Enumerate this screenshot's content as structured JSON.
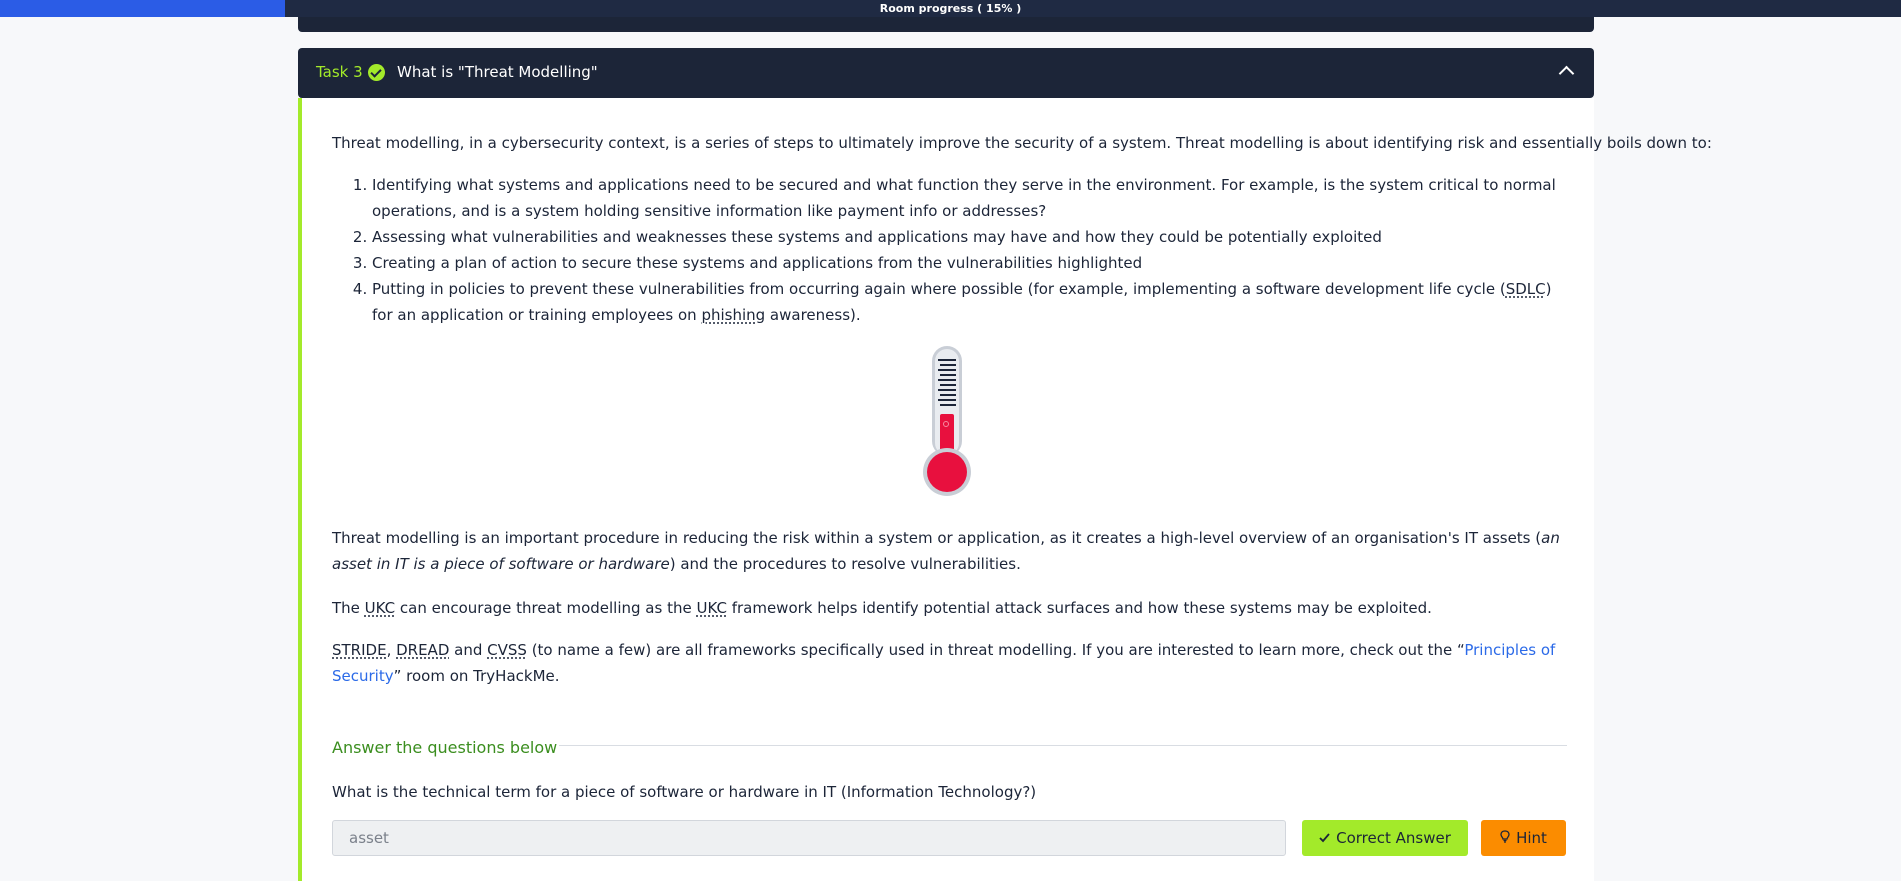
{
  "progress": {
    "label": "Room progress ( 15% )",
    "percent": 15
  },
  "task": {
    "number": "Task 3",
    "title": "What is \"Threat Modelling\""
  },
  "content": {
    "intro": "Threat modelling, in a cybersecurity context, is a series of steps to ultimately improve the security of a system. Threat modelling is about identifying risk and essentially boils down to:",
    "steps": [
      "Identifying what systems and applications need to be secured and what function they serve in the environment. For example, is the system critical to normal operations, and is a system holding sensitive information like payment info or addresses?",
      "Assessing what vulnerabilities and weaknesses these systems and applications may have and how they could be potentially exploited",
      "Creating a plan of action to secure these systems and applications from the vulnerabilities highlighted"
    ],
    "step4": {
      "before": "Putting in policies to prevent these vulnerabilities from occurring again where possible (for example, implementing a software development life cycle (",
      "abbr1": "SDLC",
      "middle": ") for an application or training employees on ",
      "abbr2": "phishing",
      "after": " awareness)."
    },
    "p2": {
      "before": "Threat modelling is an important procedure in reducing the risk within a system or application, as it creates a high-level overview of an organisation's IT assets (",
      "italic": "an asset in IT is a piece of software or hardware",
      "after": ") and the procedures to resolve vulnerabilities."
    },
    "p3": {
      "t1": "The ",
      "abbr1": "UKC",
      "t2": " can encourage threat modelling as the ",
      "abbr2": "UKC",
      "t3": " framework helps identify potential attack surfaces and how these systems may be exploited."
    },
    "p4": {
      "abbr1": "STRIDE",
      "sep1": ", ",
      "abbr2": "DREAD",
      "sep2": " and ",
      "abbr3": "CVSS",
      "t1": " (to name a few) are all frameworks specifically used in threat modelling. If you are interested to learn more, check out the “",
      "link": "Principles of Security",
      "t2": "” room on TryHackMe."
    }
  },
  "questions": {
    "heading": "Answer the questions below",
    "q1": {
      "text": "What is the technical term for a piece of software or hardware in IT (Information Technology?)",
      "answer": "asset",
      "correct_label": "Correct Answer",
      "hint_label": "Hint"
    }
  },
  "icons": {
    "task_status": "check-circle-icon",
    "collapse": "chevron-up-icon",
    "correct": "check-icon",
    "hint": "lightbulb-icon",
    "illustration": "thermometer-icon"
  },
  "colors": {
    "accent_green": "#a3ea2a",
    "header_dark": "#1c2538",
    "progress_blue": "#2b5ce6",
    "hint_orange": "#fb8c00",
    "link_blue": "#2b6ae8"
  }
}
